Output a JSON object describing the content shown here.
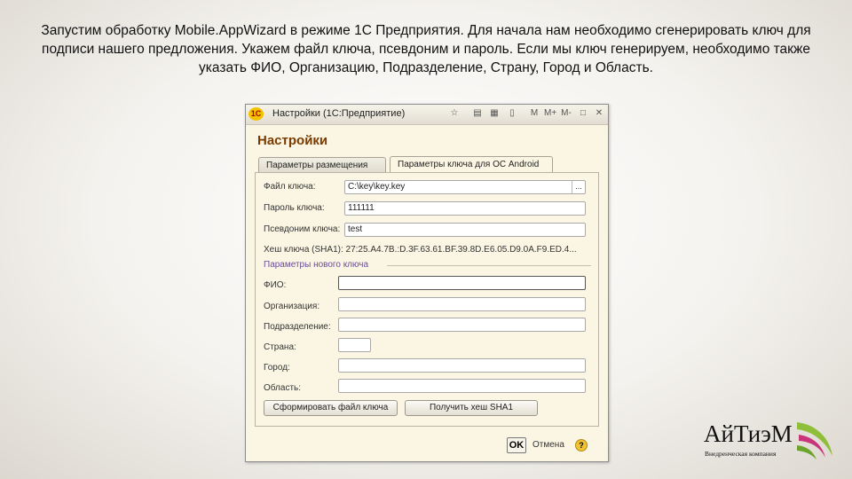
{
  "caption": "Запустим обработку Mobile.AppWizard в режиме 1С Предприятия. Для начала нам необходимо сгенерировать ключ для подписи нашего предложения. Укажем файл ключа, псевдоним и пароль. Если мы ключ генерируем, необходимо также указать ФИО, Организацию, Подразделение, Страну, Город и Область.",
  "window": {
    "title": "Настройки (1С:Предприятие)",
    "logo_text": "1С",
    "form_title": "Настройки"
  },
  "tabs": [
    {
      "label": "Параметры размещения",
      "active": false
    },
    {
      "label": "Параметры ключа для ОС Android",
      "active": true
    }
  ],
  "fields": {
    "key_file": {
      "label": "Файл ключа:",
      "value": "C:\\key\\key.key"
    },
    "key_password": {
      "label": "Пароль ключа:",
      "value": "111111"
    },
    "key_alias": {
      "label": "Псевдоним ключа:",
      "value": "test"
    },
    "hash_line": "Хеш ключа (SHA1): 27:25.A4.7B.:D.3F.63.61.BF.39.8D.E6.05.D9.0A.F9.ED.4...",
    "group_title": "Параметры нового ключа",
    "fio": {
      "label": "ФИО:",
      "value": ""
    },
    "organization": {
      "label": "Организация:",
      "value": ""
    },
    "department": {
      "label": "Подразделение:",
      "value": ""
    },
    "country": {
      "label": "Страна:",
      "value": ""
    },
    "city": {
      "label": "Город:",
      "value": ""
    },
    "region": {
      "label": "Область:",
      "value": ""
    }
  },
  "buttons": {
    "generate_key": "Сформировать файл ключа",
    "get_hash": "Получить хеш SHA1",
    "ok": "OK",
    "cancel": "Отмена",
    "help": "?"
  },
  "brand": {
    "name": "АйТиэМ",
    "subtitle": "Внедренческая компания"
  }
}
